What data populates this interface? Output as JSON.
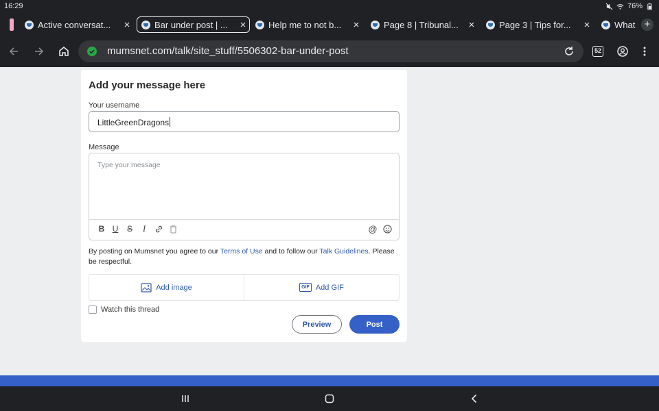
{
  "status_bar": {
    "time": "16:29",
    "battery": "76%"
  },
  "tabs": [
    {
      "title": "Active conversat...",
      "active": false
    },
    {
      "title": "Bar under post | ...",
      "active": true
    },
    {
      "title": "Help me to not b...",
      "active": false
    },
    {
      "title": "Page 8 | Tribunal...",
      "active": false
    },
    {
      "title": "Page 3 | Tips for...",
      "active": false
    },
    {
      "title": "What",
      "active": false
    }
  ],
  "toolbar": {
    "url": "mumsnet.com/talk/site_stuff/5506302-bar-under-post",
    "tab_count": "52"
  },
  "form": {
    "title": "Add your message here",
    "username_label": "Your username",
    "username_value": "LittleGreenDragons",
    "message_label": "Message",
    "message_placeholder": "Type your message",
    "terms_prefix": "By posting on Mumsnet you agree to our ",
    "terms_link": "Terms of Use",
    "terms_middle": " and to follow our ",
    "guidelines_link": "Talk Guidelines",
    "terms_suffix": ". Please be respectful.",
    "add_image": "Add image",
    "add_gif": "Add GIF",
    "gif_badge": "GIF",
    "watch_label": "Watch this thread",
    "preview_label": "Preview",
    "post_label": "Post"
  },
  "colors": {
    "accent": "#3560c7",
    "link": "#2e5aa8",
    "chrome": "#202124"
  }
}
